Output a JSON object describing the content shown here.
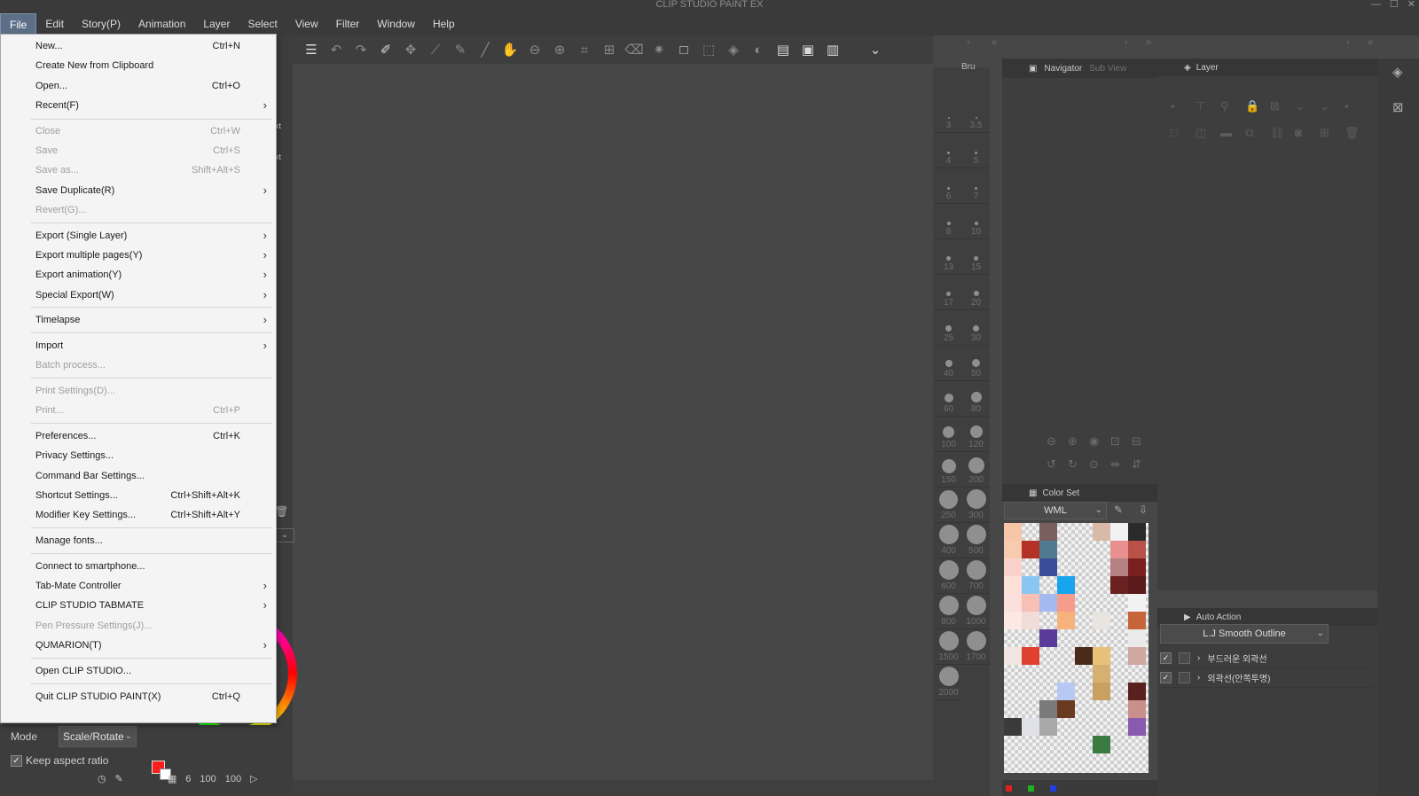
{
  "app": {
    "title": "CLIP STUDIO PAINT EX",
    "window_controls": [
      "—",
      "☐",
      "✕"
    ]
  },
  "menubar": [
    "File",
    "Edit",
    "Story(P)",
    "Animation",
    "Layer",
    "Select",
    "View",
    "Filter",
    "Window",
    "Help"
  ],
  "file_menu": {
    "items": [
      {
        "label": "New...",
        "shortcut": "Ctrl+N",
        "sub": "",
        "disabled": false
      },
      {
        "label": "Create New from Clipboard",
        "shortcut": "",
        "sub": "",
        "disabled": false
      },
      {
        "label": "Open...",
        "shortcut": "Ctrl+O",
        "sub": "",
        "disabled": false
      },
      {
        "label": "Recent(F)",
        "shortcut": "",
        "sub": "›",
        "disabled": false
      },
      {
        "label": "Close",
        "shortcut": "Ctrl+W",
        "sub": "",
        "disabled": true
      },
      {
        "label": "Save",
        "shortcut": "Ctrl+S",
        "sub": "",
        "disabled": true
      },
      {
        "label": "Save as...",
        "shortcut": "Shift+Alt+S",
        "sub": "",
        "disabled": true
      },
      {
        "label": "Save Duplicate(R)",
        "shortcut": "",
        "sub": "›",
        "disabled": false
      },
      {
        "label": "Revert(G)...",
        "shortcut": "",
        "sub": "",
        "disabled": true
      },
      {
        "label": "Export (Single Layer)",
        "shortcut": "",
        "sub": "›",
        "disabled": false
      },
      {
        "label": "Export multiple pages(Y)",
        "shortcut": "",
        "sub": "›",
        "disabled": false
      },
      {
        "label": "Export animation(Y)",
        "shortcut": "",
        "sub": "›",
        "disabled": false
      },
      {
        "label": "Special Export(W)",
        "shortcut": "",
        "sub": "›",
        "disabled": false
      },
      {
        "label": "Timelapse",
        "shortcut": "",
        "sub": "›",
        "disabled": false
      },
      {
        "label": "Import",
        "shortcut": "",
        "sub": "›",
        "disabled": false
      },
      {
        "label": "Batch process...",
        "shortcut": "",
        "sub": "",
        "disabled": true
      },
      {
        "label": "Print Settings(D)...",
        "shortcut": "",
        "sub": "",
        "disabled": true
      },
      {
        "label": "Print...",
        "shortcut": "Ctrl+P",
        "sub": "",
        "disabled": true
      },
      {
        "label": "Preferences...",
        "shortcut": "Ctrl+K",
        "sub": "",
        "disabled": false
      },
      {
        "label": "Privacy Settings...",
        "shortcut": "",
        "sub": "",
        "disabled": false
      },
      {
        "label": "Command Bar Settings...",
        "shortcut": "",
        "sub": "",
        "disabled": false
      },
      {
        "label": "Shortcut Settings...",
        "shortcut": "Ctrl+Shift+Alt+K",
        "sub": "",
        "disabled": false
      },
      {
        "label": "Modifier Key Settings...",
        "shortcut": "Ctrl+Shift+Alt+Y",
        "sub": "",
        "disabled": false
      },
      {
        "label": "Manage fonts...",
        "shortcut": "",
        "sub": "",
        "disabled": false
      },
      {
        "label": "Connect to smartphone...",
        "shortcut": "",
        "sub": "",
        "disabled": false
      },
      {
        "label": "Tab-Mate Controller",
        "shortcut": "",
        "sub": "›",
        "disabled": false
      },
      {
        "label": "CLIP STUDIO TABMATE",
        "shortcut": "",
        "sub": "›",
        "disabled": false
      },
      {
        "label": "Pen Pressure Settings(J)...",
        "shortcut": "",
        "sub": "",
        "disabled": true
      },
      {
        "label": "QUMARION(T)",
        "shortcut": "",
        "sub": "›",
        "disabled": false
      },
      {
        "label": "Open CLIP STUDIO...",
        "shortcut": "",
        "sub": "",
        "disabled": false
      },
      {
        "label": "Quit CLIP STUDIO PAINT(X)",
        "shortcut": "Ctrl+Q",
        "sub": "",
        "disabled": false
      }
    ]
  },
  "tool_property": {
    "mode_label": "Mode",
    "mode_value": "Scale/Rotate",
    "keep_aspect_label": "Keep aspect ratio",
    "keep_aspect_checked": "✓",
    "side_labels": [
      "xt",
      "xt"
    ]
  },
  "status": {
    "values": [
      "6",
      "100",
      "100"
    ]
  },
  "brush_size": {
    "tab": "Bru",
    "sizes": [
      "3",
      "3.5",
      "4",
      "5",
      "6",
      "7",
      "8",
      "10",
      "13",
      "15",
      "17",
      "20",
      "25",
      "30",
      "40",
      "50",
      "60",
      "80",
      "100",
      "120",
      "150",
      "200",
      "250",
      "300",
      "400",
      "500",
      "600",
      "700",
      "800",
      "1000",
      "1500",
      "1700",
      "2000"
    ]
  },
  "navigator": {
    "tab": "Navigator",
    "sub_tab": "Sub View"
  },
  "color_set": {
    "tab": "Color Set",
    "selected": "WML",
    "swatches": [
      "#f6c6a8",
      "",
      "#7a5f5f",
      "",
      "",
      "#d9b9a8",
      "#f2f2f2",
      "#2a2a2a",
      "#f7cbb0",
      "#b53025",
      "#4f7a8f",
      "",
      "",
      "",
      "#e88f8f",
      "#b85248",
      "#fbd2cb",
      "",
      "#3a4d9a",
      "",
      "",
      "",
      "#b58080",
      "#7a2020",
      "#fde0d8",
      "#8ac6f2",
      "",
      "#18a4ee",
      "",
      "",
      "#6b2020",
      "#5a1a1a",
      "#fce0dd",
      "#f8bfb4",
      "#a4b9f0",
      "#f79c8c",
      "",
      "",
      "",
      "#f2f2f2",
      "#fde8e3",
      "#f0dcd9",
      "",
      "#f6b27a",
      "",
      "#e8e4e0",
      "",
      "#c7653a",
      "",
      "",
      "#5a3a9a",
      "",
      "",
      "",
      "",
      "#eaeaea",
      "#f2e6e2",
      "#e04030",
      "",
      "",
      "#4a2a1a",
      "#e8c078",
      "",
      "#d0a8a0",
      "",
      "",
      "",
      "",
      "",
      "#d6b070",
      "",
      "",
      "",
      "",
      "",
      "#b8c8f4",
      "",
      "#c8a060",
      "",
      "#5a2020",
      "",
      "",
      "#7a7a7a",
      "#6a3a20",
      "",
      "",
      "",
      "#c89088",
      "#3a3a3a",
      "#e0e0e8",
      "#a8a8a8",
      "",
      "",
      "",
      "",
      "#8a5ab0",
      "",
      "",
      "",
      "",
      "",
      "#3a7a40",
      "",
      "",
      "",
      "",
      "",
      "",
      "",
      "",
      "",
      ""
    ]
  },
  "layer": {
    "tab": "Layer"
  },
  "auto_action": {
    "tab": "Auto Action",
    "selected": "L.J Smooth Outline",
    "rows": [
      {
        "checked": "✓",
        "label": "부드러운 외곽선"
      },
      {
        "checked": "✓",
        "label": "외곽선(안쪽투명)"
      }
    ]
  },
  "colors": {
    "accent_active_menu": "#5d6f87",
    "main_color": "#ff1e1e",
    "sub_color": "#ffffff"
  }
}
